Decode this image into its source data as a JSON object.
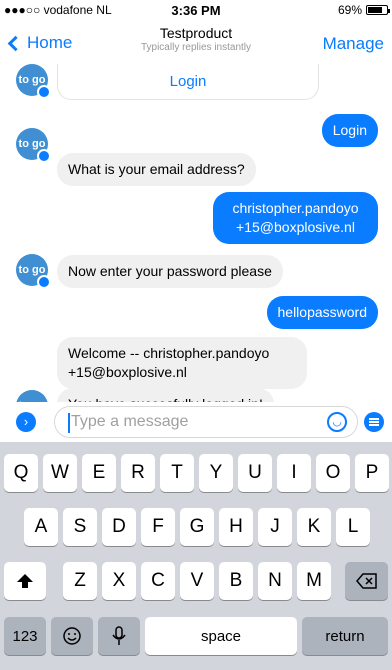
{
  "status_bar": {
    "carrier": "●●●○○ vodafone NL",
    "time": "3:36 PM",
    "battery": "69%"
  },
  "nav": {
    "back_label": "Home",
    "title": "Testproduct",
    "subtitle": "Typically replies instantly",
    "manage_label": "Manage"
  },
  "chat": {
    "bot_initials": "to go",
    "login_card_label": "Login",
    "messages": [
      {
        "from": "user",
        "text": "Login"
      },
      {
        "from": "bot",
        "text": "What is your email address?"
      },
      {
        "from": "user",
        "text": "christopher.pandoyo +15@boxplosive.nl"
      },
      {
        "from": "bot",
        "text": "Now enter your password please"
      },
      {
        "from": "user",
        "text": "hellopassword"
      },
      {
        "from": "bot",
        "text": "Welcome -- christopher.pandoyo +15@boxplosive.nl"
      },
      {
        "from": "bot",
        "text": "You have succesfully logged in!"
      }
    ]
  },
  "composer": {
    "placeholder": "Type a message"
  },
  "keyboard": {
    "row1": [
      "Q",
      "W",
      "E",
      "R",
      "T",
      "Y",
      "U",
      "I",
      "O",
      "P"
    ],
    "row2": [
      "A",
      "S",
      "D",
      "F",
      "G",
      "H",
      "J",
      "K",
      "L"
    ],
    "row3": [
      "Z",
      "X",
      "C",
      "V",
      "B",
      "N",
      "M"
    ],
    "numbers_label": "123",
    "space_label": "space",
    "return_label": "return"
  },
  "colors": {
    "accent": "#0a7cff",
    "bot_bubble": "#f0f0f0",
    "keyboard_bg": "#d2d5db"
  },
  "icons": [
    "wifi-icon",
    "back-chevron-icon",
    "bot-avatar-icon",
    "messenger-badge-icon",
    "expand-icon",
    "emoji-icon",
    "menu-icon",
    "shift-icon",
    "backspace-icon",
    "smiley-key-icon",
    "microphone-icon"
  ]
}
